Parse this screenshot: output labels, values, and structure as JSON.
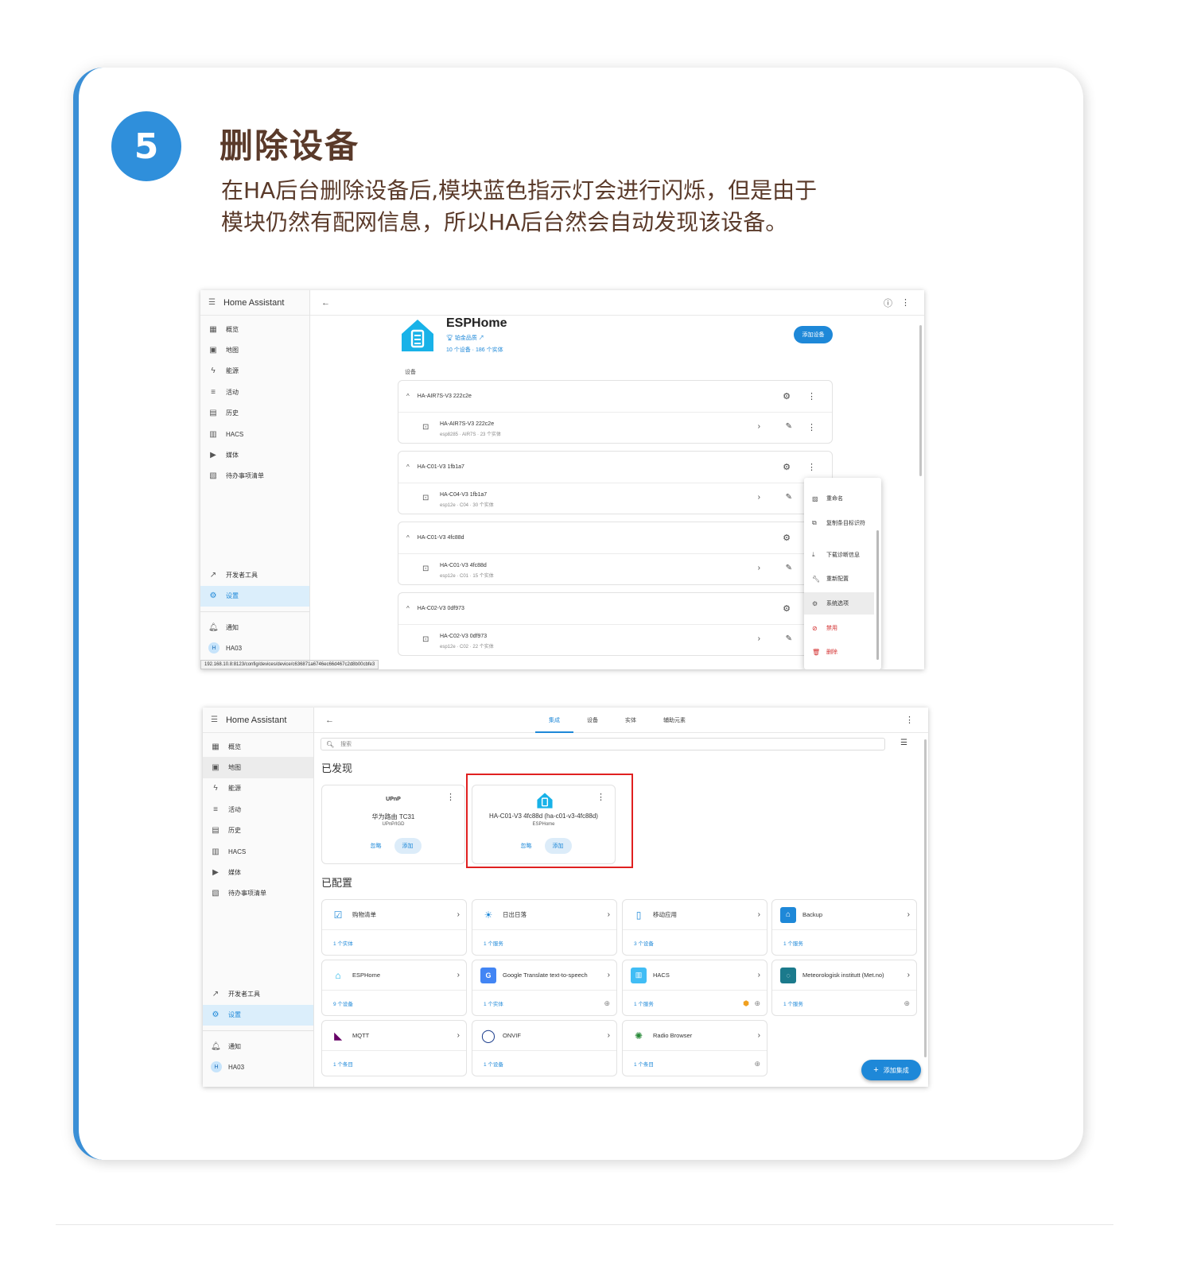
{
  "step": {
    "number": "5",
    "title": "删除设备",
    "desc1": "在HA后台删除设备后,模块蓝色指示灯会进行闪烁，但是由于",
    "desc2": "模块仍然有配网信息，所以HA后台然会自动发现该设备。"
  },
  "app": {
    "name": "Home Assistant",
    "sidebar": [
      "概览",
      "地图",
      "能源",
      "活动",
      "历史",
      "HACS",
      "媒体",
      "待办事项清单"
    ],
    "dev_tools": "开发者工具",
    "settings": "设置",
    "notifications": "通知",
    "user": "HA03",
    "user_initial": "H"
  },
  "shot1": {
    "integration": "ESPHome",
    "sub": "铂金品质",
    "stats": "10 个设备 · 186 个实体",
    "add_device": "添加设备",
    "section": "设备",
    "groups": [
      {
        "head": "HA-AIR7S-V3 222c2e",
        "name": "HA-AIR7S-V3 222c2e",
        "sub": "esp8285 · AIR7S · 23 个实体"
      },
      {
        "head": "HA-C01-V3 1fb1a7",
        "name": "HA-C04-V3 1fb1a7",
        "sub": "esp12e · C04 · 30 个实体"
      },
      {
        "head": "HA-C01-V3 4fc88d",
        "name": "HA-C01-V3 4fc88d",
        "sub": "esp12e · C01 · 15 个实体"
      },
      {
        "head": "HA-C02-V3 0df973",
        "name": "HA-C02-V3 0df973",
        "sub": "esp12e · C02 · 22 个实体"
      }
    ],
    "menu": [
      "重命名",
      "复制条目标识符",
      "下载诊断信息",
      "重新配置",
      "系统选项",
      "禁用",
      "删除"
    ],
    "status_url": "192.168.10.8:8123/config/devices/device/c636871a6746ec66d467c2d8b00cbfe3"
  },
  "shot2": {
    "tabs": [
      "集成",
      "设备",
      "实体",
      "辅助元素"
    ],
    "search_placeholder": "搜索",
    "discovered": "已发现",
    "configured": "已配置",
    "disc": [
      {
        "brand": "UPnP",
        "name": "华为路由 TC31",
        "sub": "UPnP/IGD",
        "ignore": "忽略",
        "add": "添加"
      },
      {
        "brand": "",
        "name": "HA-C01-V3 4fc88d (ha-c01-v3-4fc88d)",
        "sub": "ESPHome",
        "ignore": "忽略",
        "add": "添加"
      }
    ],
    "cards": [
      {
        "name": "购物清单",
        "count": "1 个实体"
      },
      {
        "name": "日出日落",
        "count": "1 个服务"
      },
      {
        "name": "移动应用",
        "count": "3 个设备"
      },
      {
        "name": "Backup",
        "count": "1 个服务"
      },
      {
        "name": "ESPHome",
        "count": "9 个设备"
      },
      {
        "name": "Google Translate text-to-speech",
        "count": "1 个实体"
      },
      {
        "name": "HACS",
        "count": "1 个服务"
      },
      {
        "name": "Meteorologisk institutt (Met.no)",
        "count": "1 个服务"
      },
      {
        "name": "MQTT",
        "count": "1 个条目"
      },
      {
        "name": "ONVIF",
        "count": "1 个设备"
      },
      {
        "name": "Radio Browser",
        "count": "1 个条目"
      }
    ],
    "fab": "添加集成"
  },
  "colors": {
    "accent": "#1e88d8",
    "title": "#5a3a2a",
    "step_circle": "#2f8fdb",
    "highlight": "#e02020"
  }
}
